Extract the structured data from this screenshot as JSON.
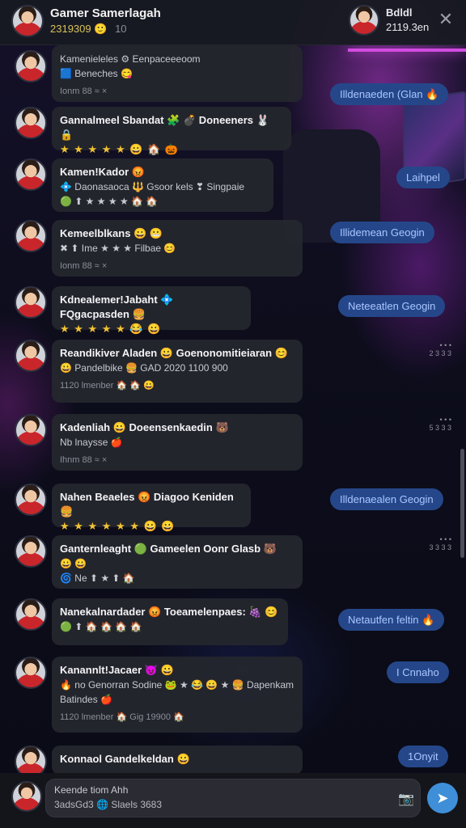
{
  "header": {
    "title": "Gamer Samerlagah",
    "subtitle": "2319309",
    "subtitle_emoji": "🙂",
    "subtitle_extra": "10",
    "peer_name": "Bdldl",
    "peer_status": "2119.3en",
    "close_icon": "✕"
  },
  "messages": [
    {
      "line1": "Kamenieleles ⚙ Eenpaceeeoom",
      "line2": "🟦 Beneches 😋",
      "line3": "Ionm 88 ≈ ×"
    },
    {
      "line1": "Gannalmeel Sbandat 🧩 💣 Doneeners 🐰 🔒",
      "line2": "★ ★ ★ ★ ★ 😀 🏠 🎃"
    },
    {
      "line1": "Kamen!Kador 😡",
      "line2": "💠 Daonasaoca 🔱 Gsoor kels ❣ Singpaie",
      "line3": "🟢 ⬆ ★ ★ ★ ★ 🏠 🏠"
    },
    {
      "line1": "Kemeelblkans 😀 😬",
      "line2": "✖ ⬆ Ime ★ ★ ★ Filbae 😊",
      "line3": "Ionm 88 ≈ ×"
    },
    {
      "line1": "Kdnealemer!Jabaht 💠 FQgacpasden 🍔",
      "line2": "★ ★ ★ ★ ★ 😂 😀"
    },
    {
      "line1": "Reandikiver Aladen 😀 Goenonomitieiaran 😊",
      "line2": "😀 Pandelbike 🍔 GAD 2020 1100 900",
      "line3": "1120 lmenber 🏠 🏠 😀"
    },
    {
      "line1": "Kadenliah 😀 Doeensenkaedin 🐻",
      "line2": "Nb lnaysse 🍎",
      "line3": "Ihnm 88 ≈ ×"
    },
    {
      "line1": "Nahen Beaeles 😡 Diagoo Keniden 🍔",
      "line2": "★ ★ ★ ★ ★ ★ 😀 😀"
    },
    {
      "line1": "Ganternleaght 🟢 Gameelen Oonr Glasb 🐻",
      "line2": "😀 😀",
      "line3": "🌀 Ne ⬆ ★ ⬆ 🏠"
    },
    {
      "line1": "Nanekalnardader 😡 Toeamelenpaes: 🍇 😊",
      "line2": "🟢 ⬆ 🏠 🏠 🏠 🏠"
    },
    {
      "line1": "Kanannlt!Jacaer 😈 😀",
      "line2": "🔥 no Genorran Sodine 🐸 ★ 😂 😀 ★ 🍔 Dapenkam",
      "line3": "Batindes 🍎",
      "line4": "1120 lmenber 🏠 Gig 19900 🏠"
    },
    {
      "line1": "Konnaol Gandelkeldan 😀"
    }
  ],
  "chips": [
    "Illdenaeden (Glan 🔥",
    "Laihpel",
    "Illidemean Geogin",
    "Neteeatlen Geogin",
    "Illdenaealen Geogin",
    "Netautfen feltin 🔥",
    "I Cnnaho",
    "1Onyit"
  ],
  "read_markers": [
    "• • •\n2 3 3 3",
    "• • •\n5 3 3 3",
    "• • •\n3 3 3 3"
  ],
  "composer": {
    "line1": "Keende tiom Ahh",
    "line2": "3adsGd3 🌐 Slaels 3683",
    "camera_icon": "📷",
    "send_icon": "➤"
  }
}
